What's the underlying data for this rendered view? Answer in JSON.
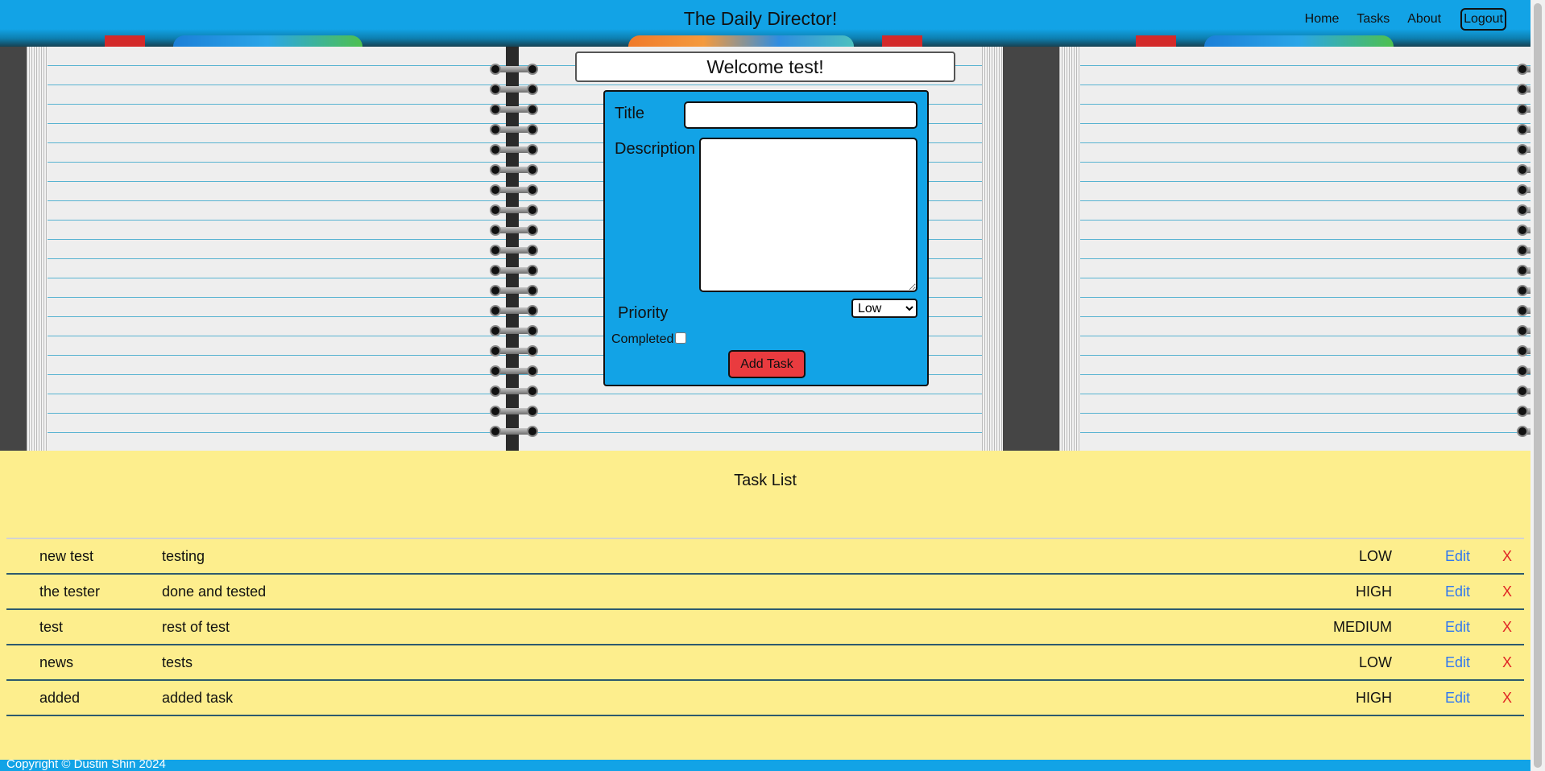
{
  "header": {
    "site_title": "The Daily Director!",
    "nav": {
      "home": "Home",
      "tasks": "Tasks",
      "about": "About"
    },
    "logout_label": "Logout"
  },
  "welcome": "Welcome test!",
  "form": {
    "title_label": "Title",
    "title_value": "",
    "description_label": "Description",
    "description_value": "",
    "priority_label": "Priority",
    "priority_selected": "Low",
    "completed_label": "Completed",
    "completed_checked": false,
    "add_button": "Add Task"
  },
  "task_list": {
    "title": "Task List",
    "edit_label": "Edit",
    "delete_label": "X",
    "tasks": [
      {
        "title": "new test",
        "description": "testing",
        "priority": "LOW"
      },
      {
        "title": "the tester",
        "description": "done and tested",
        "priority": "HIGH"
      },
      {
        "title": "test",
        "description": "rest of test",
        "priority": "MEDIUM"
      },
      {
        "title": "news",
        "description": "tests",
        "priority": "LOW"
      },
      {
        "title": "added",
        "description": "added task",
        "priority": "HIGH"
      }
    ]
  },
  "footer": {
    "copyright": "Copyright © Dustin Shin 2024"
  },
  "colors": {
    "header_blue": "#12a3e6",
    "task_area_yellow": "#fdee8d",
    "add_button_red": "#e93b3f",
    "edit_link_blue": "#3178f0",
    "delete_red": "#e02424"
  }
}
